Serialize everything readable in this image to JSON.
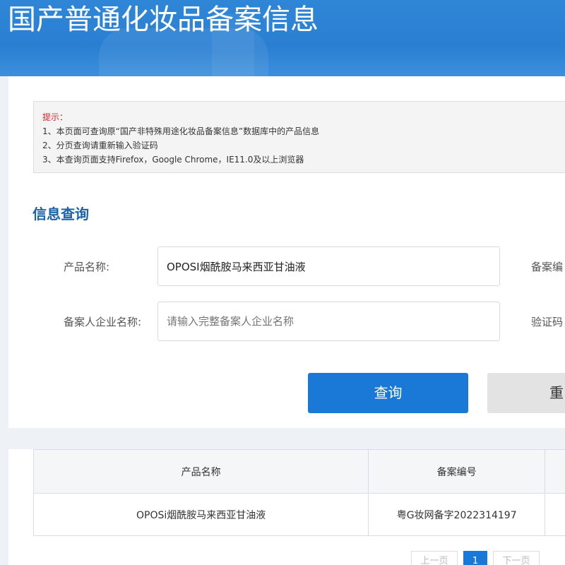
{
  "header": {
    "title": "国产普通化妆品备案信息"
  },
  "notice": {
    "title": "提示：",
    "lines": [
      "1、本页面可查询原“国产非特殊用途化妆品备案信息”数据库中的产品信息",
      "2、分页查询请重新输入验证码",
      "3、本查询页面支持Firefox，Google Chrome，IE11.0及以上浏览器"
    ]
  },
  "search": {
    "section_title": "信息查询",
    "product_name_label": "产品名称:",
    "product_name_value": "OPOSI烟酰胺马来西亚甘油液",
    "filing_number_label": "备案编",
    "company_label": "备案人企业名称:",
    "company_placeholder": "请输入完整备案人企业名称",
    "captcha_label": "验证码",
    "query_button": "查询",
    "reset_button": "重"
  },
  "results": {
    "columns": [
      "产品名称",
      "备案编号"
    ],
    "rows": [
      [
        "OPOSi烟酰胺马来西亚甘油液",
        "粤G妆网备字2022314197"
      ]
    ]
  },
  "pagination": {
    "prev": "上一页",
    "current": "1",
    "next": "下一页"
  },
  "colors": {
    "header_blue": "#2f86d6",
    "accent_blue": "#1a78d6",
    "section_title": "#1b62a8",
    "notice_red": "#d9262a"
  }
}
